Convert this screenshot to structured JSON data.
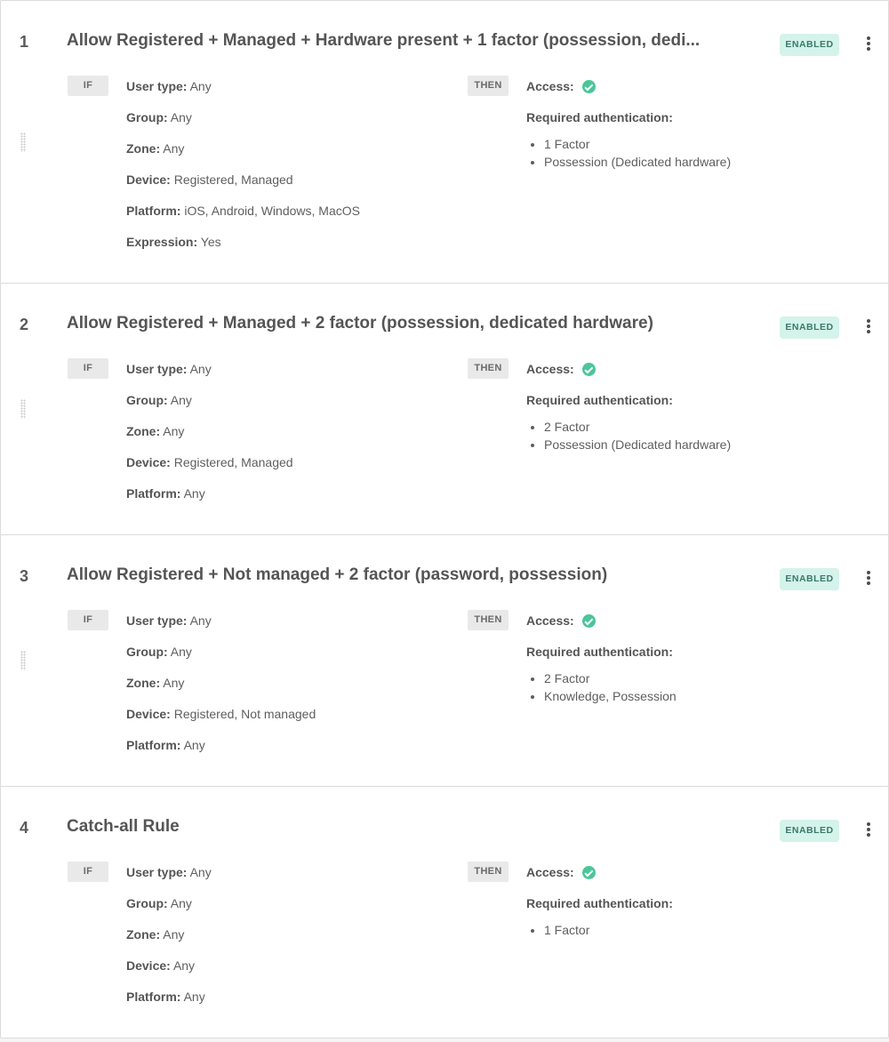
{
  "labels": {
    "if": "IF",
    "then": "THEN",
    "access": "Access:",
    "required_authentication": "Required authentication:"
  },
  "rules": [
    {
      "number": "1",
      "title": "Allow Registered + Managed + Hardware present + 1 factor (possession, dedi...",
      "status": "ENABLED",
      "conditions": [
        {
          "key": "User type:",
          "value": "Any"
        },
        {
          "key": "Group:",
          "value": "Any"
        },
        {
          "key": "Zone:",
          "value": "Any"
        },
        {
          "key": "Device:",
          "value": "Registered, Managed"
        },
        {
          "key": "Platform:",
          "value": "iOS, Android, Windows, MacOS"
        },
        {
          "key": "Expression:",
          "value": "Yes"
        }
      ],
      "access_icon": "check-circle-icon",
      "required_authentication": [
        "1 Factor",
        "Possession (Dedicated hardware)"
      ]
    },
    {
      "number": "2",
      "title": "Allow Registered + Managed + 2 factor (possession, dedicated hardware)",
      "status": "ENABLED",
      "conditions": [
        {
          "key": "User type:",
          "value": "Any"
        },
        {
          "key": "Group:",
          "value": "Any"
        },
        {
          "key": "Zone:",
          "value": "Any"
        },
        {
          "key": "Device:",
          "value": "Registered, Managed"
        },
        {
          "key": "Platform:",
          "value": "Any"
        }
      ],
      "access_icon": "check-circle-icon",
      "required_authentication": [
        "2 Factor",
        "Possession (Dedicated hardware)"
      ]
    },
    {
      "number": "3",
      "title": "Allow Registered + Not managed + 2 factor (password, possession)",
      "status": "ENABLED",
      "conditions": [
        {
          "key": "User type:",
          "value": "Any"
        },
        {
          "key": "Group:",
          "value": "Any"
        },
        {
          "key": "Zone:",
          "value": "Any"
        },
        {
          "key": "Device:",
          "value": "Registered, Not managed"
        },
        {
          "key": "Platform:",
          "value": "Any"
        }
      ],
      "access_icon": "check-circle-icon",
      "required_authentication": [
        "2 Factor",
        "Knowledge, Possession"
      ]
    },
    {
      "number": "4",
      "title": "Catch-all Rule",
      "status": "ENABLED",
      "conditions": [
        {
          "key": "User type:",
          "value": "Any"
        },
        {
          "key": "Group:",
          "value": "Any"
        },
        {
          "key": "Zone:",
          "value": "Any"
        },
        {
          "key": "Device:",
          "value": "Any"
        },
        {
          "key": "Platform:",
          "value": "Any"
        }
      ],
      "access_icon": "check-circle-icon",
      "required_authentication": [
        "1 Factor"
      ]
    }
  ],
  "colors": {
    "enabled_badge_bg": "#d4f3ea",
    "enabled_badge_text": "#3b7a66",
    "access_check": "#4cc59a"
  }
}
